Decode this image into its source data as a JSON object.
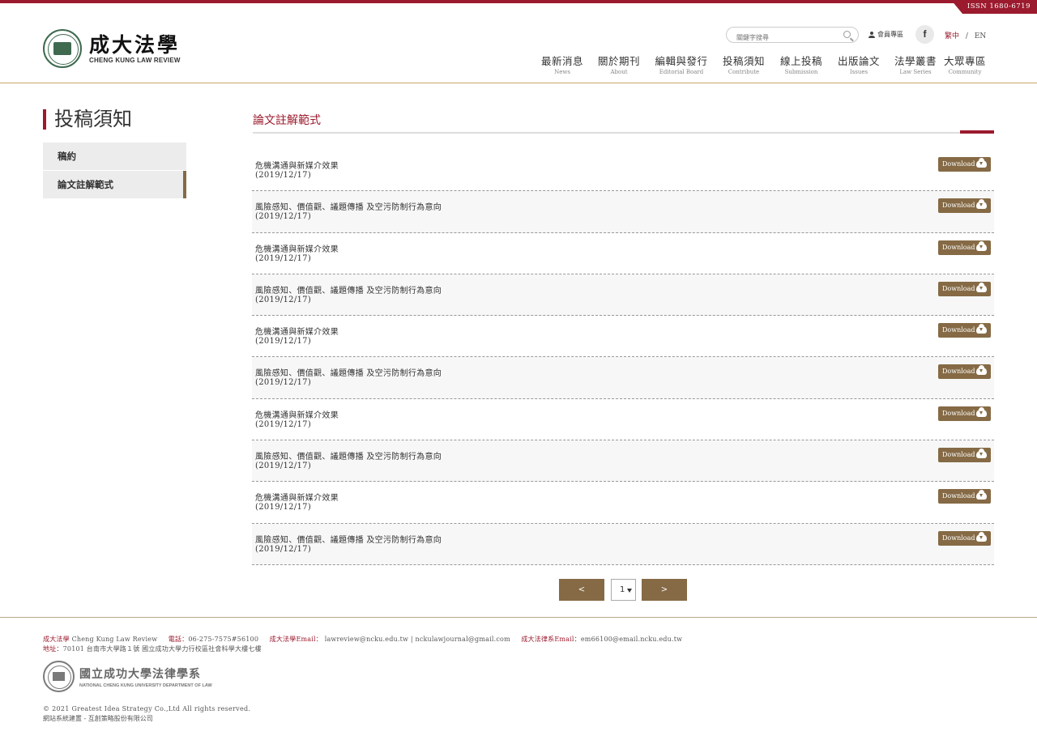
{
  "issn": "ISSN 1680-6719",
  "logo": {
    "cn": "成大法學",
    "en": "CHENG KUNG LAW REVIEW"
  },
  "search": {
    "placeholder": "關鍵字搜尋"
  },
  "member": "會員專區",
  "facebook": "f",
  "lang": {
    "zh": "繁中",
    "sep": "/",
    "en": "EN"
  },
  "nav": [
    {
      "cn": "最新消息",
      "en": "News"
    },
    {
      "cn": "關於期刊",
      "en": "About"
    },
    {
      "cn": "編輯與發行",
      "en": "Editorial Board"
    },
    {
      "cn": "投稿須知",
      "en": "Contribute"
    },
    {
      "cn": "線上投稿",
      "en": "Submission"
    },
    {
      "cn": "出版論文",
      "en": "Issues"
    },
    {
      "cn": "法學叢書",
      "en": "Law Series"
    },
    {
      "cn": "大眾專區",
      "en": "Community"
    }
  ],
  "sidebar": {
    "title": "投稿須知",
    "items": [
      {
        "label": "稿約"
      },
      {
        "label": "論文註解範式"
      }
    ]
  },
  "main": {
    "title": "論文註解範式",
    "download_label": "Download",
    "rows": [
      {
        "title": "危機溝通與新媒介效果",
        "date": "(2019/12/17)"
      },
      {
        "title": "風險感知、價值觀、議題傳播 及空污防制行為意向",
        "date": "(2019/12/17)"
      },
      {
        "title": "危機溝通與新媒介效果",
        "date": "(2019/12/17)"
      },
      {
        "title": "風險感知、價值觀、議題傳播 及空污防制行為意向",
        "date": "(2019/12/17)"
      },
      {
        "title": "危機溝通與新媒介效果",
        "date": "(2019/12/17)"
      },
      {
        "title": "風險感知、價值觀、議題傳播 及空污防制行為意向",
        "date": "(2019/12/17)"
      },
      {
        "title": "危機溝通與新媒介效果",
        "date": "(2019/12/17)"
      },
      {
        "title": "風險感知、價值觀、議題傳播 及空污防制行為意向",
        "date": "(2019/12/17)"
      },
      {
        "title": "危機溝通與新媒介效果",
        "date": "(2019/12/17)"
      },
      {
        "title": "風險感知、價值觀、議題傳播 及空污防制行為意向",
        "date": "(2019/12/17)"
      }
    ]
  },
  "pager": {
    "prev": "<",
    "page": "1",
    "next": ">"
  },
  "footer": {
    "name_label": "成大法學",
    "name": "Cheng Kung Law Review",
    "tel_label": "電話：",
    "tel": "06-275-7575#56100",
    "email_label": "成大法學Email：",
    "email": "lawreview@ncku.edu.tw | nckulawjournal@gmail.com",
    "dept_email_label": "成大法律系Email：",
    "dept_email": "em66100@email.ncku.edu.tw",
    "addr_label": "地址：",
    "addr": "70101 台南市大學路１號 國立成功大學力行校區社會科學大樓七樓",
    "logo_cn": "國立成功大學法律學系",
    "logo_en": "NATIONAL CHENG KUNG UNIVERSITY DEPARTMENT OF LAW",
    "copyright": "© 2021 Greatest Idea Strategy Co.,Ltd All rights reserved.",
    "builder": "網站系統建置 - 互創策略股份有限公司"
  }
}
